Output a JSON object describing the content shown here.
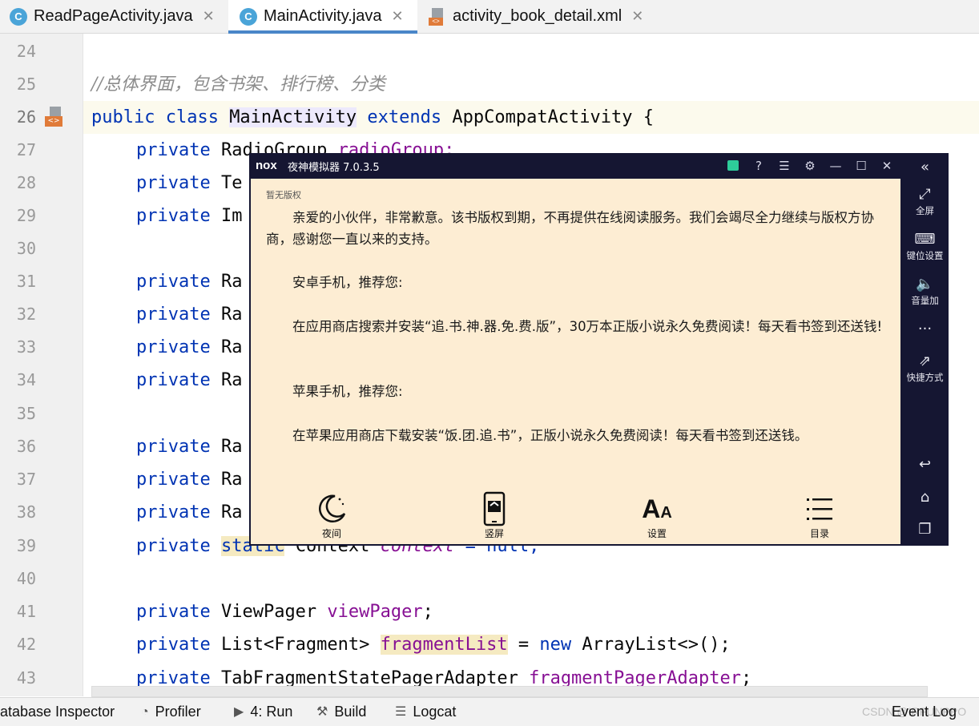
{
  "tabs": [
    {
      "label": "ReadPageActivity.java",
      "icon": "c-class-icon",
      "active": false
    },
    {
      "label": "MainActivity.java",
      "icon": "c-class-icon",
      "active": true
    },
    {
      "label": "activity_book_detail.xml",
      "icon": "xml-layout-icon",
      "active": false
    }
  ],
  "editor": {
    "line_numbers": [
      "24",
      "25",
      "26",
      "27",
      "28",
      "29",
      "30",
      "31",
      "32",
      "33",
      "34",
      "35",
      "36",
      "37",
      "38",
      "39",
      "40",
      "41",
      "42",
      "43"
    ],
    "comment": "//总体界面，包含书架、排行榜、分类",
    "class_decl": {
      "kw1": "public class ",
      "name": "MainActivity",
      "kw2": " extends ",
      "parent": "AppCompatActivity {"
    },
    "line27": {
      "kw": "private ",
      "type": "RadioGroup ",
      "field": "radioGroup;"
    },
    "line28": {
      "kw": "private ",
      "type": "Te"
    },
    "line29": {
      "kw": "private ",
      "type": "Im"
    },
    "line31": {
      "kw": "private ",
      "type": "Ra"
    },
    "line32": {
      "kw": "private ",
      "type": "Ra"
    },
    "line33": {
      "kw": "private ",
      "type": "Ra"
    },
    "line34": {
      "kw": "private ",
      "type": "Ra"
    },
    "line36": {
      "kw": "private ",
      "type": "Ra"
    },
    "line37": {
      "kw": "private ",
      "type": "Ra"
    },
    "line38": {
      "kw": "private ",
      "type": "Ra"
    },
    "line39": {
      "kw": "private ",
      "kw2": "static",
      "type": " Context ",
      "field": "context",
      "rest": " = null;"
    },
    "line41": {
      "kw": "private ",
      "type": "ViewPager ",
      "field": "viewPager",
      "rest": ";"
    },
    "line42": {
      "kw": "private ",
      "type": "List<Fragment> ",
      "field": "fragmentList",
      "rest1": " = ",
      "kw2": "new",
      "rest2": " ArrayList<>();"
    },
    "line43": {
      "kw": "private ",
      "type": "TabFragmentStatePagerAdapter ",
      "field": "fragmentPagerAdapter",
      "rest": ";"
    }
  },
  "statusbar": {
    "items": [
      "atabase Inspector",
      "Profiler",
      "4: Run",
      "Build",
      "Logcat",
      "Event Log"
    ],
    "watermark": "CSDN @IRFUNPPO"
  },
  "emulator": {
    "logo": "nox",
    "title": "夜神模拟器 7.0.3.5",
    "screen": {
      "label": "暂无版权",
      "paragraphs": [
        "　　亲爱的小伙伴，非常歉意。该书版权到期，不再提供在线阅读服务。我们会竭尽全力继续与版权方协商，感谢您一直以来的支持。",
        "　　安卓手机，推荐您:",
        "　　在应用商店搜索并安装“追.书.神.器.免.费.版”，30万本正版小说永久免费阅读！每天看书签到还送钱!",
        "　　苹果手机，推荐您:",
        "　　在苹果应用商店下载安装“饭.团.追.书”，正版小说永久免费阅读！每天看书签到还送钱。"
      ],
      "menu": [
        {
          "label": "夜间",
          "icon": "moon-icon"
        },
        {
          "label": "竖屏",
          "icon": "portrait-phone-icon"
        },
        {
          "label": "设置",
          "icon": "font-size-icon"
        },
        {
          "label": "目录",
          "icon": "list-icon"
        }
      ]
    },
    "side": [
      {
        "label": "全屏",
        "icon": "fullscreen-icon"
      },
      {
        "label": "键位设置",
        "icon": "keyboard-icon"
      },
      {
        "label": "音量加",
        "icon": "volume-up-icon"
      },
      {
        "label": "",
        "icon": "more-icon"
      },
      {
        "label": "快捷方式",
        "icon": "shortcut-icon"
      },
      {
        "label": "",
        "icon": "back-icon"
      },
      {
        "label": "",
        "icon": "home-icon"
      },
      {
        "label": "",
        "icon": "recent-apps-icon"
      }
    ],
    "colors": {
      "chrome": "#151632",
      "screen": "#fdedd3"
    }
  }
}
